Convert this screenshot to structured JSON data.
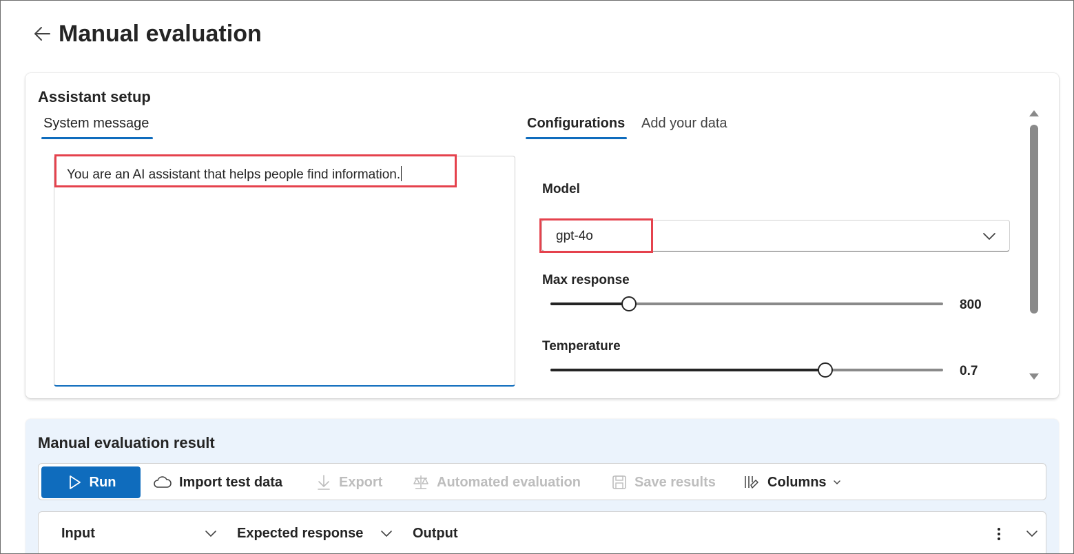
{
  "page": {
    "title": "Manual evaluation"
  },
  "setup": {
    "title": "Assistant setup",
    "tabs": {
      "system_message": "System message",
      "configurations": "Configurations",
      "add_data": "Add your data"
    },
    "system_message_text": "You are an AI assistant that helps people find information.",
    "model": {
      "label": "Model",
      "value": "gpt-4o"
    },
    "max_response": {
      "label": "Max response",
      "value": "800",
      "fraction": 0.2
    },
    "temperature": {
      "label": "Temperature",
      "value": "0.7",
      "fraction": 0.7
    }
  },
  "results": {
    "title": "Manual evaluation result",
    "toolbar": {
      "run": "Run",
      "import": "Import test data",
      "export": "Export",
      "automated": "Automated evaluation",
      "save": "Save results",
      "columns": "Columns"
    },
    "columns": [
      "Input",
      "Expected response",
      "Output"
    ]
  },
  "colors": {
    "accent": "#0f6cbd",
    "highlight": "#e5424d",
    "result_bg": "#ebf3fc"
  }
}
